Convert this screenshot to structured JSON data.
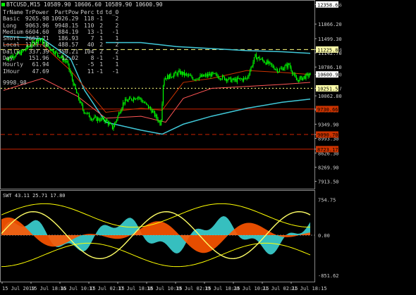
{
  "header": {
    "symbol": "BTCUSD,M15",
    "ohlc": "10589.90 10606.60 10589.90 10600.90"
  },
  "info_table": {
    "columns": [
      "TrName",
      "TrPower",
      "PartPow",
      "Perc",
      "td",
      "td_0"
    ],
    "rows": [
      [
        "Basic",
        "9265.98",
        "10926.29",
        "118",
        "-1",
        "2"
      ],
      [
        "Long",
        "9063.96",
        "9948.15",
        "110",
        "2",
        "2"
      ],
      [
        "Medium",
        "6604.60",
        "884.19",
        "13",
        "-1",
        "-1"
      ],
      [
        "Short",
        "2667.71",
        "186.93",
        "7",
        "1",
        "1"
      ],
      [
        "Local",
        "1121.18",
        "488.57",
        "40",
        "2",
        "2"
      ],
      [
        "Daily",
        "337.39",
        "350.21",
        "104",
        "2",
        "2"
      ],
      [
        "Day",
        "151.96",
        "12.02",
        "8",
        "-1",
        "-1"
      ],
      [
        "Hourly",
        "61.94",
        "-",
        "-5",
        "1",
        "1"
      ],
      [
        "IHour",
        "47.69",
        "",
        "11",
        "-1",
        "-1"
      ]
    ],
    "last_value": "9998.98"
  },
  "price_axis": {
    "labels": [
      "12358.66",
      "11866.20",
      "11499.30",
      "11225.84",
      "11142.70",
      "10786.10",
      "10600.90",
      "10251.57",
      "10062.80",
      "9706.10",
      "9730.66",
      "9349.90",
      "9090.70",
      "8993.30",
      "8723.17",
      "8626.30",
      "8269.90",
      "7913.50"
    ],
    "tags": [
      {
        "text": "12358.66",
        "bg": "#ffffff",
        "fg": "#000000"
      },
      {
        "text": "11225.84",
        "bg": "#ffffaa",
        "fg": "#000000"
      },
      {
        "text": "10600.90",
        "bg": "#ffffff",
        "fg": "#000000"
      },
      {
        "text": "10251.57",
        "bg": "#ffffaa",
        "fg": "#000000"
      },
      {
        "text": "9730.66",
        "bg": "#cc3300",
        "fg": "#000000"
      },
      {
        "text": "9090.70",
        "bg": "#cc3300",
        "fg": "#000000"
      },
      {
        "text": "8723.17",
        "bg": "#cc3300",
        "fg": "#000000"
      }
    ]
  },
  "sub_window": {
    "title": "SWT 43.11 25.71 17.80",
    "labels": [
      "754.75",
      "0.00",
      "-851.62"
    ]
  },
  "time_axis": {
    "labels": [
      "15 Jul 2019",
      "15 Jul 18:15",
      "16 Jul 10:15",
      "17 Jul 02:15",
      "17 Jul 18:15",
      "18 Jul 10:15",
      "19 Jul 02:15",
      "19 Jul 18:15",
      "20 Jul 10:15",
      "21 Jul 02:15",
      "21 Jul 18:15"
    ]
  },
  "colors": {
    "up": "#00ff00",
    "cyan": "#40c8d8",
    "red": "#cc2200",
    "yellow": "#ffff00",
    "orange": "#ff5500",
    "aqua": "#40e0e0",
    "grid": "#333333"
  }
}
